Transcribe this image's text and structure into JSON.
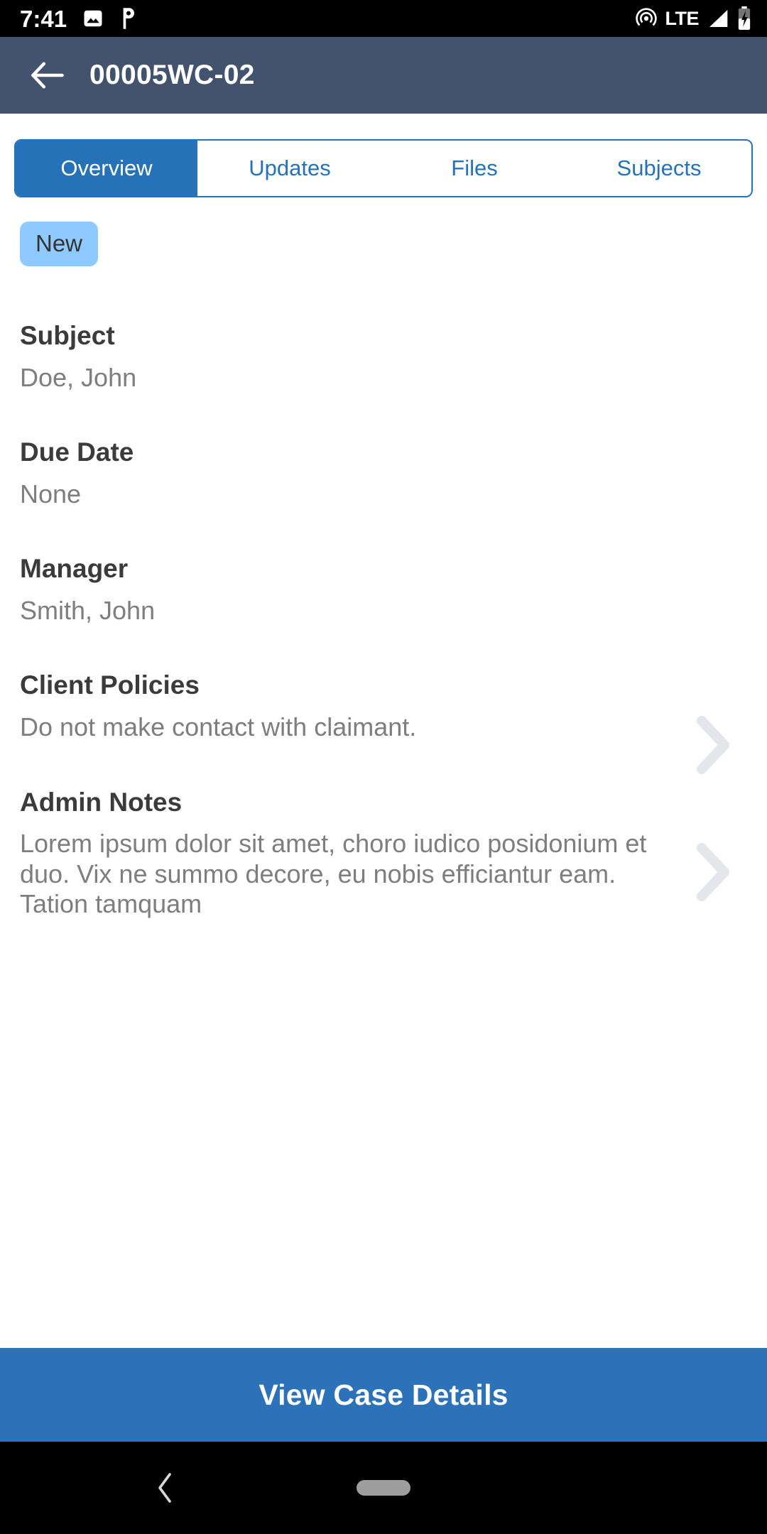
{
  "status_bar": {
    "time": "7:41",
    "left_icons": [
      "photo-icon",
      "pushbullet-p-icon"
    ],
    "network_label": "LTE",
    "right_icons": [
      "cast-icon",
      "signal-icon",
      "battery-charging-icon"
    ],
    "background": "#000000",
    "foreground": "#ffffff"
  },
  "header": {
    "back_icon": "arrow-left-icon",
    "title": "00005WC-02",
    "background": "#44536d",
    "text_color": "#ffffff"
  },
  "tabs": {
    "active_index": 0,
    "accent": "#2572b8",
    "items": [
      {
        "label": "Overview"
      },
      {
        "label": "Updates"
      },
      {
        "label": "Files"
      },
      {
        "label": "Subjects"
      }
    ]
  },
  "status_badge": {
    "label": "New",
    "background": "#8ecaff",
    "text_color": "#333333"
  },
  "fields": [
    {
      "label": "Subject",
      "value": "Doe, John",
      "chevron": false
    },
    {
      "label": "Due Date",
      "value": "None",
      "chevron": false
    },
    {
      "label": "Manager",
      "value": "Smith, John",
      "chevron": false
    },
    {
      "label": "Client Policies",
      "value": "Do not make contact with claimant.",
      "chevron": true
    },
    {
      "label": "Admin Notes",
      "value": "Lorem ipsum dolor sit amet, choro iudico posidonium et duo. Vix ne summo decore, eu nobis efficiantur eam. Tation tamquam",
      "chevron": true
    }
  ],
  "chevron_icon": "chevron-right-icon",
  "chevron_color": "#e3e6eb",
  "primary_button": {
    "label": "View Case Details",
    "background": "#2c72b8",
    "text_color": "#ffffff"
  },
  "nav_bar": {
    "back_icon": "chevron-left-icon",
    "home_icon": "home-pill-icon",
    "background": "#000000",
    "pill_color": "#9e9e9e"
  }
}
